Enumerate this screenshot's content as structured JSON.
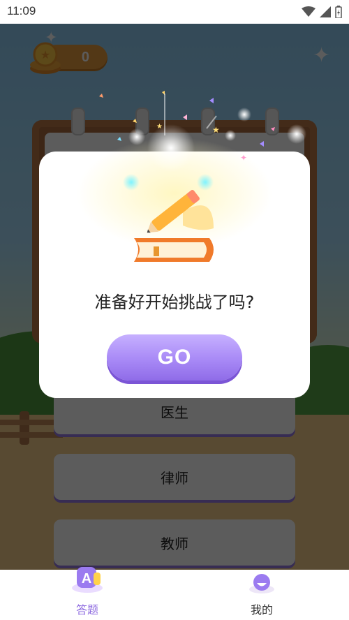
{
  "status_bar": {
    "time": "11:09",
    "icons": [
      "wifi-icon",
      "signal-icon",
      "battery-charging-icon"
    ]
  },
  "coins": {
    "value": "0"
  },
  "dialog": {
    "question": "准备好开始挑战了吗?",
    "go_label": "GO"
  },
  "options": [
    {
      "label": "医生"
    },
    {
      "label": "律师"
    },
    {
      "label": "教师"
    }
  ],
  "bottom_nav": {
    "items": [
      {
        "label": "答题",
        "icon": "quiz-a-icon",
        "active": true
      },
      {
        "label": "我的",
        "icon": "profile-face-icon",
        "active": false
      }
    ]
  },
  "colors": {
    "accent": "#9b7bf0",
    "active_nav": "#8e6be0",
    "overlay": "rgba(0,0,0,0.64)",
    "go_button": "#a889f6"
  }
}
